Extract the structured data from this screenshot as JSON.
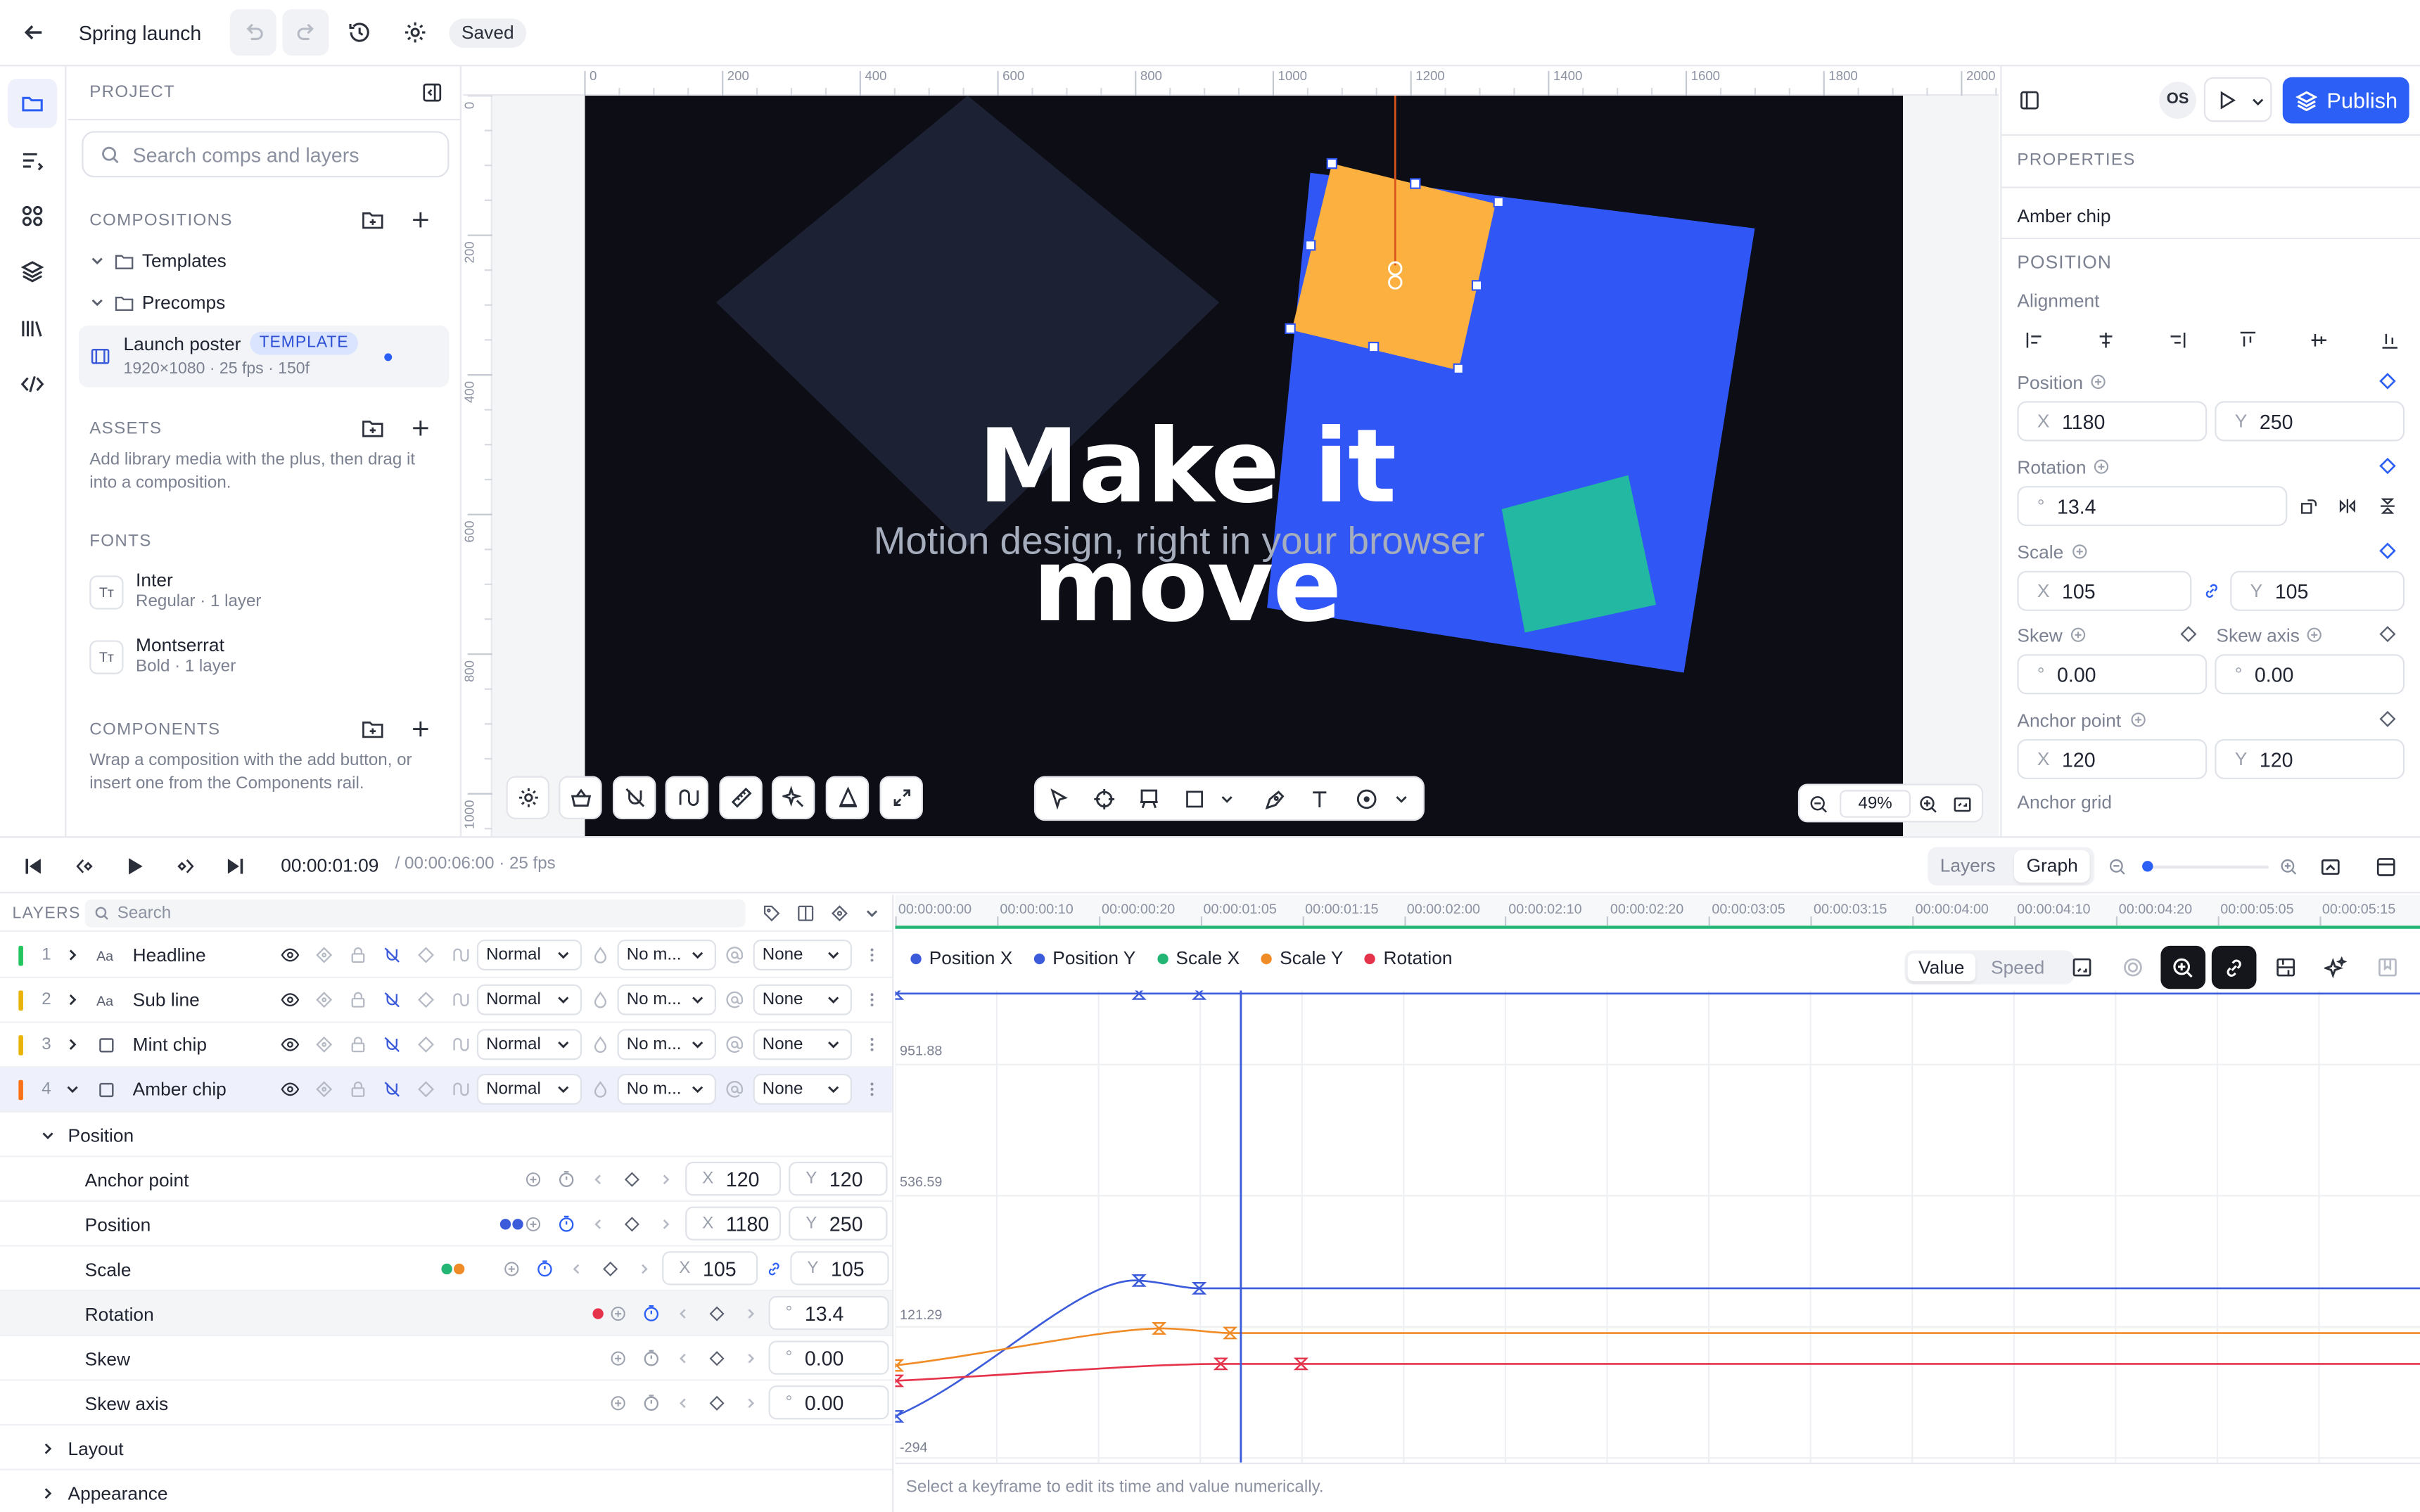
{
  "topbar": {
    "title": "Spring launch",
    "saved": "Saved"
  },
  "left_panel": {
    "project_label": "PROJECT",
    "search_placeholder": "Search comps and layers",
    "compositions_label": "COMPOSITIONS",
    "folders": [
      "Templates",
      "Precomps"
    ],
    "comp": {
      "name": "Launch poster",
      "badge": "TEMPLATE",
      "meta": "1920×1080 · 25 fps · 150f"
    },
    "assets_label": "ASSETS",
    "assets_hint": "Add library media with the plus, then drag it into a composition.",
    "fonts_label": "FONTS",
    "fonts": [
      {
        "name": "Inter",
        "meta": "Regular · 1 layer"
      },
      {
        "name": "Montserrat",
        "meta": "Bold · 1 layer"
      }
    ],
    "components_label": "COMPONENTS",
    "components_hint": "Wrap a composition with the add button, or insert one from the Components rail."
  },
  "ruler": {
    "top": [
      "0",
      "200",
      "400",
      "600",
      "800",
      "1000",
      "1200",
      "1400",
      "1600",
      "1800",
      "2000"
    ],
    "left": [
      "0",
      "200",
      "400",
      "600",
      "800",
      "1000"
    ]
  },
  "canvas": {
    "headline": "Make it move",
    "subline": "Motion design, right in your browser",
    "zoom": "49%"
  },
  "right_panel": {
    "avatar": "OS",
    "publish": "Publish",
    "properties_label": "PROPERTIES",
    "layer_name": "Amber chip",
    "position_label": "POSITION",
    "alignment_label": "Alignment",
    "position": {
      "label": "Position",
      "x": "1180",
      "y": "250"
    },
    "rotation": {
      "label": "Rotation",
      "value": "13.4"
    },
    "scale": {
      "label": "Scale",
      "x": "105",
      "y": "105"
    },
    "skew": {
      "label": "Skew",
      "value": "0.00",
      "axis_label": "Skew axis",
      "axis_value": "0.00"
    },
    "anchor": {
      "label": "Anchor point",
      "x": "120",
      "y": "120"
    },
    "anchor_grid_label": "Anchor grid"
  },
  "transport": {
    "time": "00:00:01:09",
    "total": "/ 00:00:06:00 · 25 fps",
    "tabs": [
      "Layers",
      "Graph"
    ]
  },
  "layers": {
    "label": "LAYERS",
    "search_placeholder": "Search",
    "rows": [
      {
        "num": "1",
        "name": "Headline",
        "blend": "Normal",
        "matte": "No m...",
        "parent": "None",
        "color": "#22c55e"
      },
      {
        "num": "2",
        "name": "Sub line",
        "blend": "Normal",
        "matte": "No m...",
        "parent": "None",
        "color": "#eab308"
      },
      {
        "num": "3",
        "name": "Mint chip",
        "blend": "Normal",
        "matte": "No m...",
        "parent": "None",
        "color": "#eab308"
      },
      {
        "num": "4",
        "name": "Amber chip",
        "blend": "Normal",
        "matte": "No m...",
        "parent": "None",
        "color": "#f97316"
      }
    ],
    "group": "Position",
    "props": [
      {
        "name": "Anchor point",
        "x": "120",
        "y": "120"
      },
      {
        "name": "Position",
        "x": "1180",
        "y": "250"
      },
      {
        "name": "Scale",
        "x": "105",
        "y": "105"
      },
      {
        "name": "Rotation",
        "value": "13.4"
      },
      {
        "name": "Skew",
        "value": "0.00"
      },
      {
        "name": "Skew axis",
        "value": "0.00"
      }
    ],
    "sections": [
      "Layout",
      "Appearance"
    ]
  },
  "timeline": {
    "ticks": [
      "00:00:00:00",
      "00:00:00:10",
      "00:00:00:20",
      "00:00:01:05",
      "00:00:01:15",
      "00:00:02:00",
      "00:00:02:10",
      "00:00:02:20",
      "00:00:03:05",
      "00:00:03:15",
      "00:00:04:00",
      "00:00:04:10",
      "00:00:04:20",
      "00:00:05:05",
      "00:00:05:15"
    ],
    "legend": [
      {
        "name": "Position X",
        "color": "#3b5bdb"
      },
      {
        "name": "Position Y",
        "color": "#3b5bdb"
      },
      {
        "name": "Scale X",
        "color": "#22b573"
      },
      {
        "name": "Scale Y",
        "color": "#f08c28"
      },
      {
        "name": "Rotation",
        "color": "#e5334b"
      }
    ],
    "mode": [
      "Value",
      "Speed"
    ],
    "y_labels": [
      "951.88",
      "536.59",
      "121.29",
      "-294"
    ],
    "hint": "Select a keyframe to edit its time and value numerically."
  }
}
